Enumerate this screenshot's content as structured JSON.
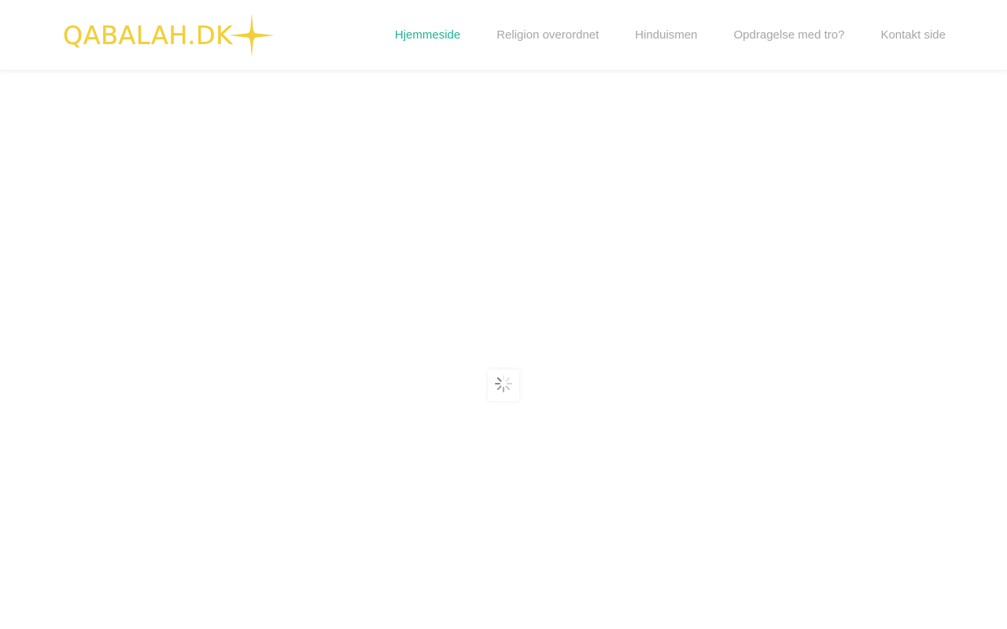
{
  "brand": {
    "logo_text": "QABALAH.DK",
    "logo_color": "#f2cf3a"
  },
  "nav": {
    "items": [
      {
        "label": "Hjemmeside",
        "active": true
      },
      {
        "label": "Religion overordnet",
        "active": false
      },
      {
        "label": "Hinduismen",
        "active": false
      },
      {
        "label": "Opdragelse med tro?",
        "active": false
      },
      {
        "label": "Kontakt side",
        "active": false
      }
    ],
    "active_color": "#1db394",
    "inactive_color": "#a3a6ab"
  },
  "loader": {
    "icon": "loading-spinner-icon"
  }
}
